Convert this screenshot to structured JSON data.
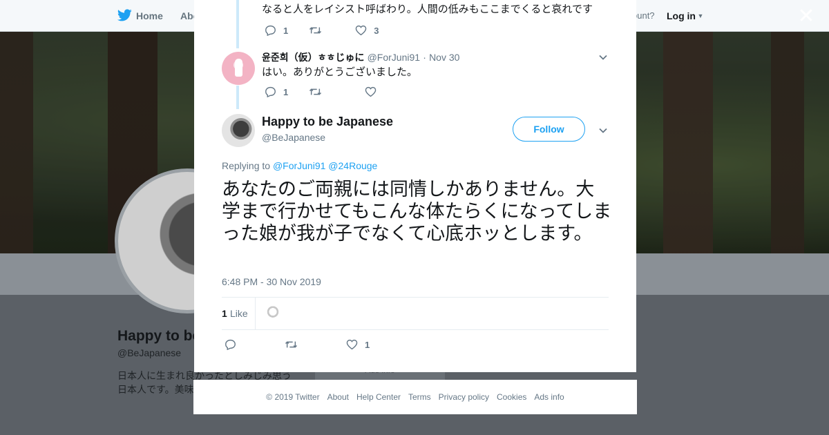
{
  "nav": {
    "home_label": "Home",
    "about_label": "Abo",
    "account_text": "ccount?",
    "login_label": "Log in"
  },
  "profile": {
    "name": "Happy to be",
    "handle": "@BeJapanese",
    "bio": "日本人に生まれ良かったとしみじみ思う日本人です。美味あるしね。フォロです",
    "tab_fragment": "Ads info"
  },
  "thread": {
    "prev_reply_text": "なると人をレイシスト呼ばわり。人間の低みもここまでくると哀れです",
    "prev_reply_counts": {
      "replies": "1",
      "likes": "3"
    },
    "reply": {
      "name": "윤준희（仮）ㅎㅎじゅに",
      "handle": "@ForJuni91",
      "separator": "·",
      "date": "Nov 30",
      "text": "はい。ありがとうございました。",
      "replies": "1"
    }
  },
  "main_tweet": {
    "name": "Happy to be Japanese",
    "handle": "@BeJapanese",
    "follow_label": "Follow",
    "replying_prefix": "Replying to",
    "replying_to_1": "@ForJuni91",
    "replying_to_2": "@24Rouge",
    "text": "あなたのご両親には同情しかありません。大学まで行かせてもこんな体たらくになってしまった娘が我が子でなくて心底ホッとします。",
    "timestamp": "6:48 PM - 30 Nov 2019",
    "likes_count": "1",
    "likes_label": "Like",
    "action_like_count": "1"
  },
  "footer": {
    "links": [
      "© 2019 Twitter",
      "About",
      "Help Center",
      "Terms",
      "Privacy policy",
      "Cookies",
      "Ads info"
    ]
  },
  "colors": {
    "accent": "#1da1f2",
    "thread_line": "#cde9fa",
    "muted": "#657786"
  },
  "icons": [
    "twitter-bird-icon",
    "caret-down-icon",
    "close-icon",
    "reply-icon",
    "retweet-icon",
    "heart-icon",
    "chevron-down-icon"
  ]
}
